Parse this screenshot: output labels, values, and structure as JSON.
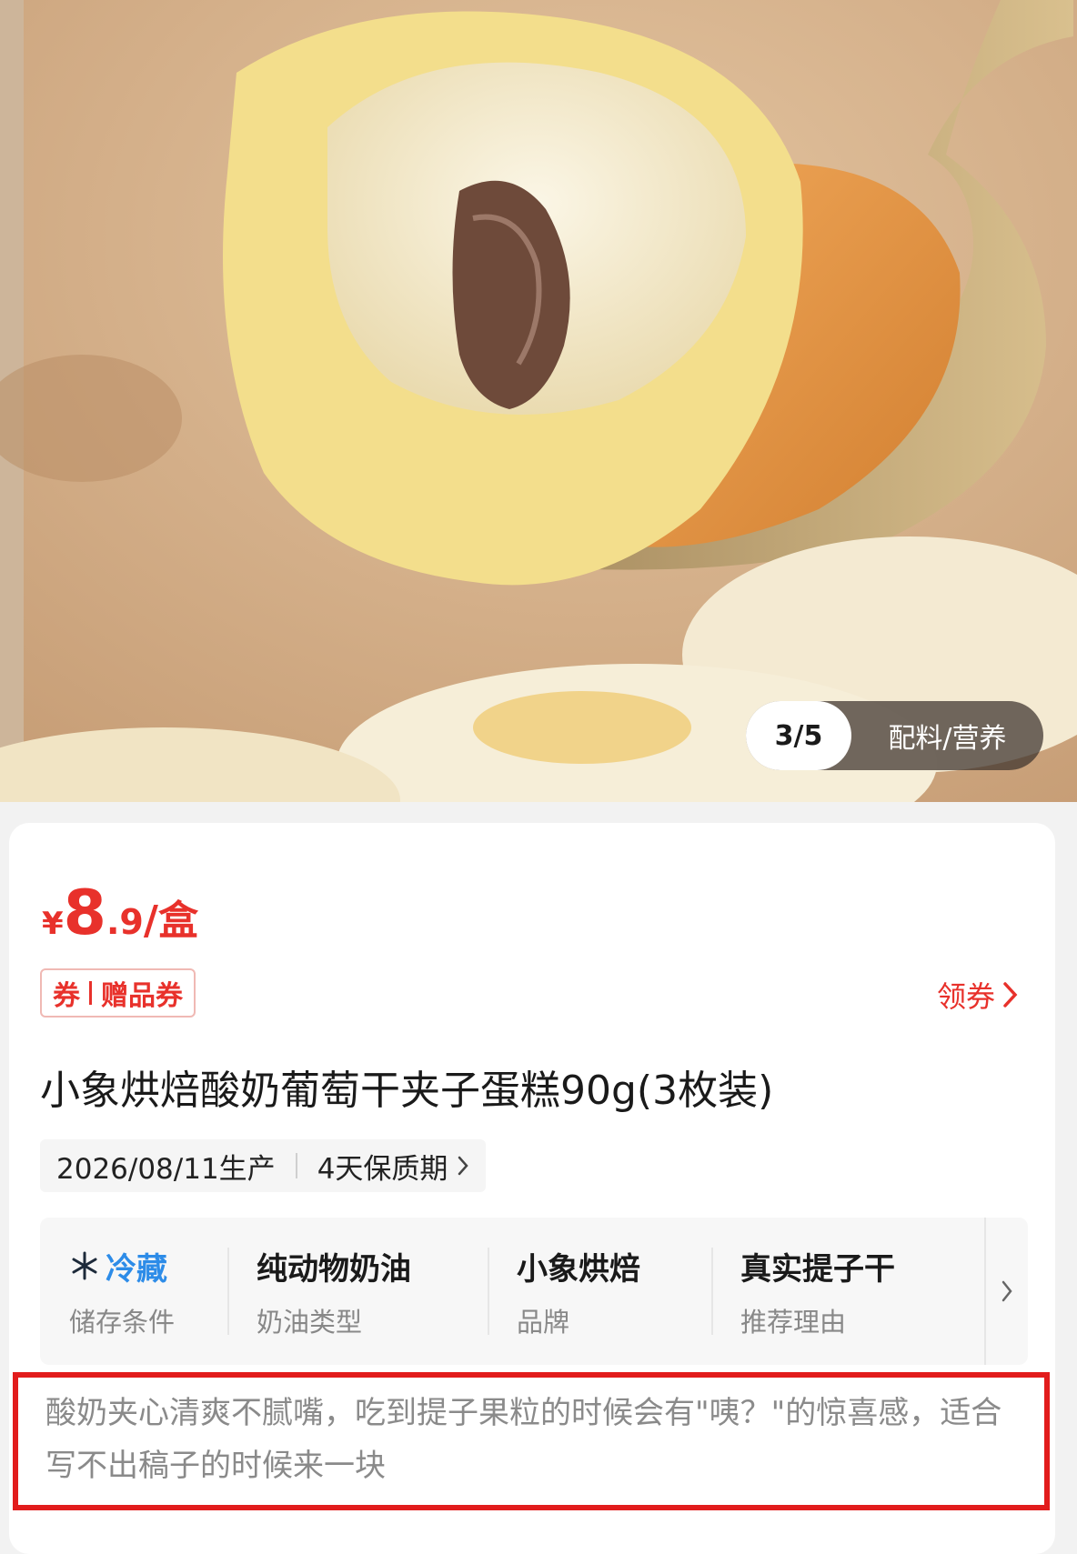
{
  "gallery": {
    "counter": "3/5",
    "tab": "配料/营养"
  },
  "price": {
    "symbol": "¥",
    "integer": "8",
    "decimal": ".9",
    "unit": "/盒",
    "color": "#e8312b"
  },
  "coupon": {
    "prefix": "券",
    "label": "赠品券",
    "action": "领券"
  },
  "product": {
    "title": "小象烘焙酸奶葡萄干夹子蛋糕90g(3枚装)",
    "production_date": "2026/08/11生产",
    "shelf_life": "4天保质期"
  },
  "attributes": [
    {
      "value": "冷藏",
      "label": "储存条件",
      "icon": "snowflake-icon"
    },
    {
      "value": "纯动物奶油",
      "label": "奶油类型"
    },
    {
      "value": "小象烘焙",
      "label": "品牌"
    },
    {
      "value": "真实提子干",
      "label": "推荐理由"
    }
  ],
  "review": {
    "text": "酸奶夹心清爽不腻嘴，吃到提子果粒的时候会有\"咦？\"的惊喜感，适合写不出稿子的时候来一块",
    "highlight_color": "#e21c1c"
  }
}
